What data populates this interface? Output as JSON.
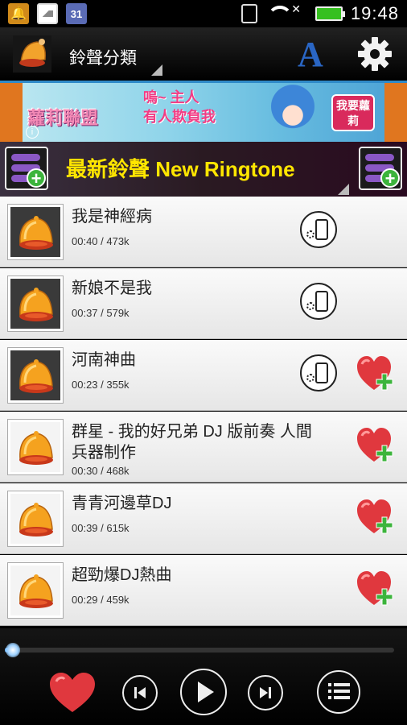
{
  "status_bar": {
    "time": "19:48",
    "calendar_icon_text": "31"
  },
  "action_bar": {
    "category_label": "鈴聲分類",
    "font_button": "A"
  },
  "banner": {
    "brand_text": "蘿莉聯盟",
    "slogan_line1": "嗚~ 主人",
    "slogan_line2": "有人欺負我",
    "cta_label": "我要蘿莉",
    "info_label": "i"
  },
  "list_header": {
    "title": "最新鈴聲 New Ringtone"
  },
  "ringtones": [
    {
      "title": "我是神經病",
      "meta": "00:40 / 473k",
      "thumb_style": "dark",
      "has_set_ringtone": true,
      "has_favorite": false
    },
    {
      "title": "新娘不是我",
      "meta": "00:37 / 579k",
      "thumb_style": "dark",
      "has_set_ringtone": true,
      "has_favorite": false
    },
    {
      "title": "河南神曲",
      "meta": "00:23 / 355k",
      "thumb_style": "dark",
      "has_set_ringtone": true,
      "has_favorite": true
    },
    {
      "title": "群星 - 我的好兄弟 DJ 版前奏 人間兵器制作",
      "meta": "00:30 / 468k",
      "thumb_style": "light",
      "has_set_ringtone": false,
      "has_favorite": true
    },
    {
      "title": "青青河邊草DJ",
      "meta": "00:39 / 615k",
      "thumb_style": "light",
      "has_set_ringtone": false,
      "has_favorite": true
    },
    {
      "title": "超勁爆DJ熱曲",
      "meta": "00:29 / 459k",
      "thumb_style": "light",
      "has_set_ringtone": false,
      "has_favorite": true
    }
  ],
  "player": {
    "progress_fraction": 0.01
  },
  "colors": {
    "accent_blue": "#2f8ac8",
    "header_title_yellow": "#ffe600",
    "favorite_red": "#e0383e",
    "plus_green": "#3cb43c"
  }
}
